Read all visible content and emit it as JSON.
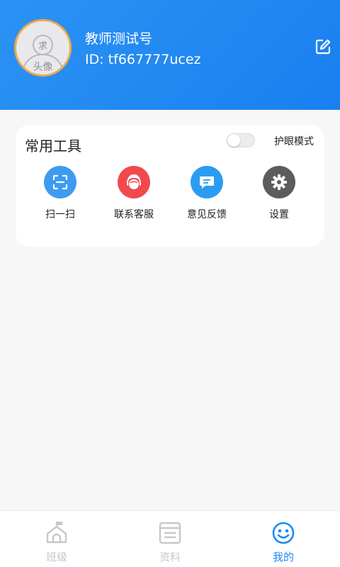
{
  "header": {
    "avatar_top": "求",
    "avatar_bottom": "头像",
    "user_name": "教师测试号",
    "user_id": "ID:  tf667777ucez"
  },
  "tools_card": {
    "title": "常用工具",
    "eye_mode_label": "护眼模式",
    "eye_mode_on": false,
    "items": [
      {
        "label": "扫一扫",
        "icon": "scan-icon",
        "color": "#3d9bf0"
      },
      {
        "label": "联系客服",
        "icon": "customer-service-icon",
        "color": "#f04a4f"
      },
      {
        "label": "意见反馈",
        "icon": "feedback-icon",
        "color": "#2b9cf2"
      },
      {
        "label": "设置",
        "icon": "settings-gear-icon",
        "color": "#5c5c5c"
      }
    ]
  },
  "tabbar": {
    "tabs": [
      {
        "label": "班级",
        "icon": "class-house-icon",
        "active": false
      },
      {
        "label": "资料",
        "icon": "materials-doc-icon",
        "active": false
      },
      {
        "label": "我的",
        "icon": "smiley-face-icon",
        "active": true
      }
    ]
  },
  "colors": {
    "header_blue": "#1a7ff0",
    "active_tab": "#1c8cf2",
    "inactive_tab": "#c7c7cc",
    "avatar_border": "#f0a94a"
  }
}
